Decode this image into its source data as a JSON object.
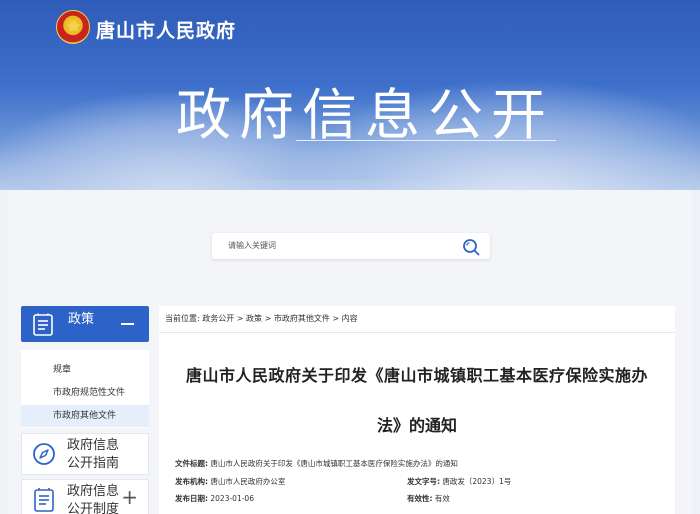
{
  "header": {
    "site_name": "唐山市人民政府",
    "page_title": "政府信息公开"
  },
  "search": {
    "placeholder": "请输入关键词"
  },
  "sidebar": {
    "policy_label": "政策",
    "sub_items": [
      {
        "label": "规章",
        "active": false
      },
      {
        "label": "市政府规范性文件",
        "active": false
      },
      {
        "label": "市政府其他文件",
        "active": true
      }
    ],
    "cards": [
      {
        "label": "政府信息公开指南",
        "line1": "政府信息",
        "line2": "公开指南",
        "icon": "compass-icon"
      },
      {
        "label": "政府信息公开制度",
        "line1": "政府信息",
        "line2": "公开制度",
        "icon": "document-icon"
      }
    ]
  },
  "breadcrumb": {
    "prefix": "当前位置:",
    "items": [
      "政务公开",
      "政策",
      "市政府其他文件",
      "内容"
    ],
    "separator": ">"
  },
  "document": {
    "title_line1": "唐山市人民政府关于印发《唐山市城镇职工基本医疗保险实施办",
    "title_line2": "法》的通知",
    "meta": {
      "file_title_label": "文件标题:",
      "file_title": "唐山市人民政府关于印发《唐山市城镇职工基本医疗保险实施办法》的通知",
      "issuer_label": "发布机构:",
      "issuer": "唐山市人民政府办公室",
      "doc_no_label": "发文字号:",
      "doc_no": "唐政发〔2023〕1号",
      "date_label": "发布日期:",
      "date": "2023-01-06",
      "validity_label": "有效性:",
      "validity": "有效"
    }
  },
  "colors": {
    "banner": "#3d6fcb",
    "accent": "#2d63c9",
    "active_bg": "#e7eefb"
  }
}
